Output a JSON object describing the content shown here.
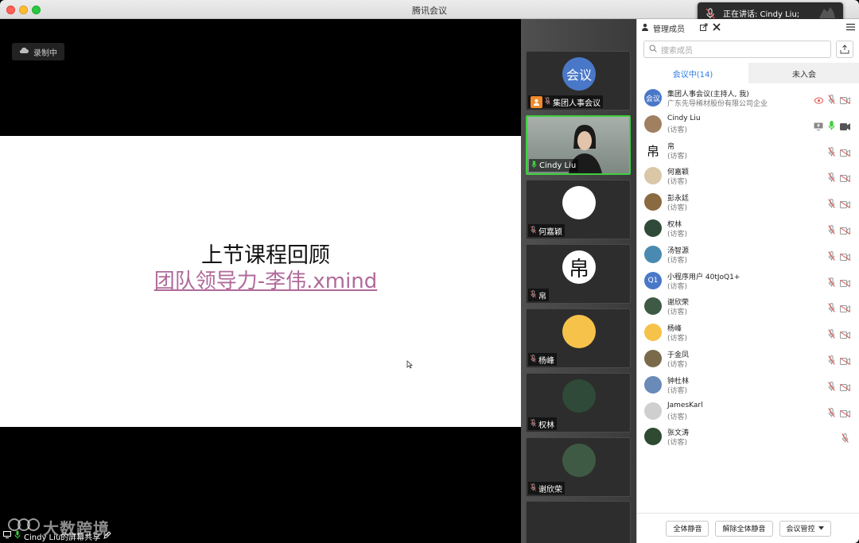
{
  "window": {
    "title": "腾讯会议"
  },
  "speaking_toast": {
    "text": "正在讲话: Cindy Liu;"
  },
  "share": {
    "recording_label": "录制中",
    "slide_title": "上节课程回顾",
    "slide_link": "团队领导力-李伟.xmind",
    "footer_label": "Cindy Liu的屏幕共享",
    "watermark": "大数跨境"
  },
  "tiles": [
    {
      "name": "集团人事会议",
      "avatar_text": "会议",
      "avatar_color": "#4a78c8",
      "host": true,
      "active": false
    },
    {
      "name": "Cindy Liu",
      "avatar_text": "",
      "avatar_color": "#9aa39c",
      "host": false,
      "active": true
    },
    {
      "name": "何嘉颖",
      "avatar_text": "",
      "avatar_color": "#ffffff",
      "host": false,
      "active": false
    },
    {
      "name": "帛",
      "avatar_text": "帛",
      "avatar_color": "#ffffff",
      "host": false,
      "active": false
    },
    {
      "name": "杨峰",
      "avatar_text": "",
      "avatar_color": "#f7c24a",
      "host": false,
      "active": false
    },
    {
      "name": "权林",
      "avatar_text": "",
      "avatar_color": "#2f4a38",
      "host": false,
      "active": false
    },
    {
      "name": "谢欣荣",
      "avatar_text": "",
      "avatar_color": "#3f5a44",
      "host": false,
      "active": false
    }
  ],
  "panel": {
    "tab_label": "管理成员",
    "search_placeholder": "搜索成员",
    "seg_in": "会议中(14)",
    "seg_out": "未入会",
    "buttons": {
      "mute_all": "全体静音",
      "unmute_all": "解除全体静音",
      "control": "会议管控"
    }
  },
  "members": [
    {
      "name": "集团人事会议(主持人, 我)",
      "role": "广东先导稀材股份有限公司企业",
      "avatar_text": "会议",
      "avatar_color": "#4a78c8",
      "mic": "muted",
      "share": false,
      "rec": true
    },
    {
      "name": "Cindy Liu",
      "role": "(访客)",
      "avatar_text": "",
      "avatar_color": "#a08060",
      "mic": "on",
      "share": true,
      "rec": false
    },
    {
      "name": "帛",
      "role": "(访客)",
      "avatar_text": "帛",
      "avatar_color": "#ffffff",
      "mic": "muted",
      "share": false,
      "rec": false
    },
    {
      "name": "何嘉颖",
      "role": "(访客)",
      "avatar_text": "",
      "avatar_color": "#d9c7a8",
      "mic": "muted",
      "share": false,
      "rec": false
    },
    {
      "name": "彭永廷",
      "role": "(访客)",
      "avatar_text": "",
      "avatar_color": "#8a6a40",
      "mic": "muted",
      "share": false,
      "rec": false
    },
    {
      "name": "权林",
      "role": "(访客)",
      "avatar_text": "",
      "avatar_color": "#2f4a38",
      "mic": "muted",
      "share": false,
      "rec": false
    },
    {
      "name": "汤智源",
      "role": "(访客)",
      "avatar_text": "",
      "avatar_color": "#4a8ab0",
      "mic": "muted",
      "share": false,
      "rec": false
    },
    {
      "name": "小程序用户 40tJoQ1+",
      "role": "(访客)",
      "avatar_text": "Q1",
      "avatar_color": "#4a78c8",
      "mic": "muted",
      "share": false,
      "rec": false
    },
    {
      "name": "谢欣荣",
      "role": "(访客)",
      "avatar_text": "",
      "avatar_color": "#3f5a44",
      "mic": "muted",
      "share": false,
      "rec": false
    },
    {
      "name": "杨峰",
      "role": "(访客)",
      "avatar_text": "",
      "avatar_color": "#f7c24a",
      "mic": "muted",
      "share": false,
      "rec": false
    },
    {
      "name": "于金凤",
      "role": "(访客)",
      "avatar_text": "",
      "avatar_color": "#7a6a4a",
      "mic": "muted",
      "share": false,
      "rec": false
    },
    {
      "name": "钟杜林",
      "role": "(访客)",
      "avatar_text": "",
      "avatar_color": "#6a8ab8",
      "mic": "muted",
      "share": false,
      "rec": false
    },
    {
      "name": "JamesKarl",
      "role": "(访客)",
      "avatar_text": "",
      "avatar_color": "#cfcfcf",
      "mic": "muted",
      "share": false,
      "rec": false
    },
    {
      "name": "张文涛",
      "role": "(访客)",
      "avatar_text": "",
      "avatar_color": "#2e4a30",
      "mic": "muted",
      "share": false,
      "rec": false,
      "no_cam": true
    }
  ]
}
